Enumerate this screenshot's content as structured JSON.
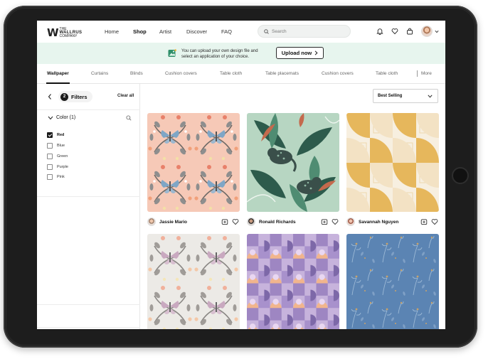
{
  "brand": {
    "logo_mark": "W",
    "line1": "THE",
    "line2": "WALLRUS",
    "line3": "COMPANY"
  },
  "nav": {
    "home": "Home",
    "shop": "Shop",
    "artist": "Artist",
    "discover": "Discover",
    "faq": "FAQ"
  },
  "search": {
    "placeholder": "Search"
  },
  "header_icons": [
    "bell-icon",
    "heart-icon",
    "bag-icon",
    "avatar",
    "chevron-down-icon"
  ],
  "banner": {
    "text": "You can upload your own design file and select an application of your choice.",
    "button": "Upload now",
    "button_icon": "chevron-right-icon"
  },
  "categories": [
    {
      "label": "Wallpaper",
      "active": true
    },
    {
      "label": "Curtains"
    },
    {
      "label": "Blinds"
    },
    {
      "label": "Cushion covers"
    },
    {
      "label": "Table cloth"
    },
    {
      "label": "Table placemats"
    },
    {
      "label": "Cushion covers"
    },
    {
      "label": "Table cloth"
    },
    {
      "label": "More"
    }
  ],
  "filters": {
    "count": "2",
    "label": "Filters",
    "clear": "Clear all",
    "color_title": "Color (1)",
    "options": [
      {
        "label": "Red",
        "checked": true
      },
      {
        "label": "Blue",
        "checked": false
      },
      {
        "label": "Green",
        "checked": false
      },
      {
        "label": "Purple",
        "checked": false
      },
      {
        "label": "Pink",
        "checked": false
      }
    ]
  },
  "sort": {
    "label": "Best Selling"
  },
  "products": [
    {
      "artist": "Jassie Mario",
      "pattern": "butterfly-floral-peach"
    },
    {
      "artist": "Ronald Richards",
      "pattern": "tropical-leopard-green"
    },
    {
      "artist": "Savannah Nguyen",
      "pattern": "geometric-squares-mustard"
    },
    {
      "artist": "",
      "pattern": "butterfly-floral-grey"
    },
    {
      "artist": "",
      "pattern": "geometric-circles-lavender"
    },
    {
      "artist": "",
      "pattern": "botanical-sketch-blue"
    }
  ],
  "colors": {
    "banner_bg": "#e7f5ee",
    "accent": "#1c1c1c",
    "frame": "#1d1d1d"
  }
}
